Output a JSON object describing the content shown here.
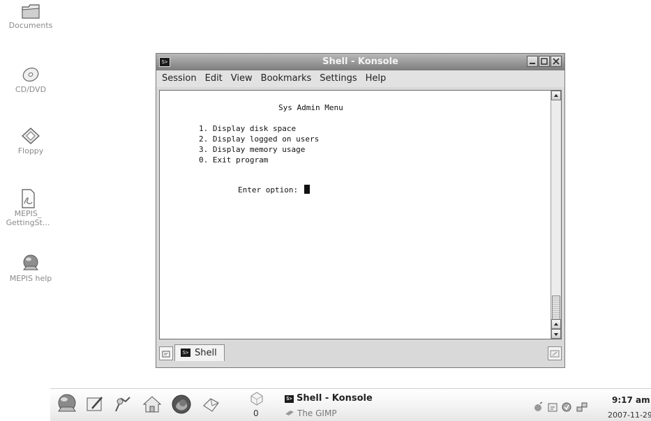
{
  "desktop": {
    "icons": [
      {
        "label": "Documents",
        "icon": "folder-icon"
      },
      {
        "label": "CD/DVD",
        "icon": "cdrom-icon"
      },
      {
        "label": "Floppy",
        "icon": "floppy-icon"
      },
      {
        "label": "MEPIS_",
        "label2": "GettingSt...",
        "icon": "pdf-document-icon"
      },
      {
        "label": "MEPIS help",
        "icon": "help-icon"
      }
    ]
  },
  "window": {
    "title": "Shell - Konsole",
    "menu": [
      "Session",
      "Edit",
      "View",
      "Bookmarks",
      "Settings",
      "Help"
    ],
    "terminal": {
      "heading": "Sys Admin Menu",
      "options": [
        "1. Display disk space",
        "2. Display logged on users",
        "3. Display memory usage",
        "0. Exit program"
      ],
      "prompt": "Enter option: "
    },
    "tabs": [
      {
        "label": "Shell"
      }
    ]
  },
  "taskbar": {
    "active_task": "Shell - Konsole",
    "secondary_task": "The GIMP",
    "desktop_count": "0",
    "clock_time": "9:17 am",
    "clock_date": "2007-11-29"
  },
  "colors": {
    "titlebar": "#7c7c7c",
    "terminal_bg": "#ffffff",
    "desktop_bg": "#ffffff"
  }
}
